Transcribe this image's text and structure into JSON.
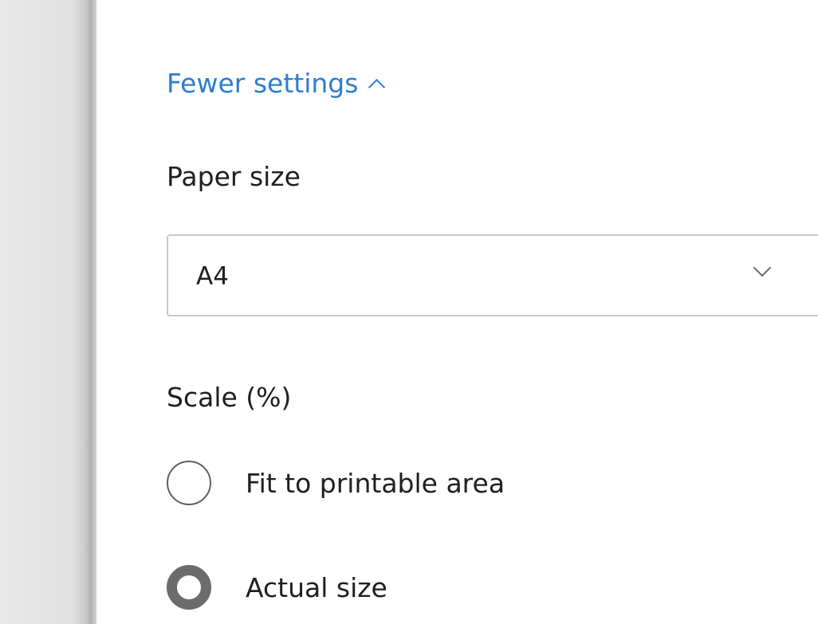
{
  "settings_toggle": {
    "label": "Fewer settings",
    "icon": "chevron-up-icon",
    "color": "#2c7ecf"
  },
  "paper_size": {
    "label": "Paper size",
    "selected": "A4",
    "icon": "chevron-down-icon"
  },
  "scale": {
    "label": "Scale (%)",
    "options": [
      {
        "label": "Fit to printable area",
        "selected": false
      },
      {
        "label": "Actual size",
        "selected": true
      }
    ]
  }
}
